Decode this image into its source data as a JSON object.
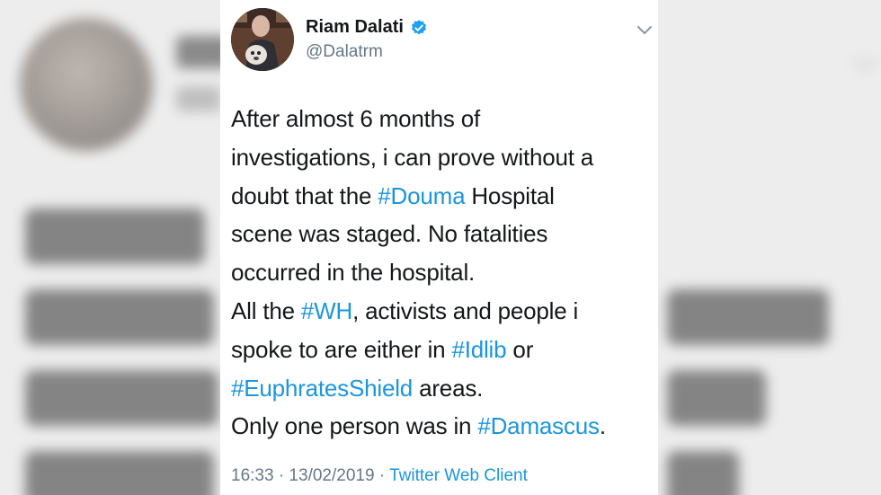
{
  "tweet": {
    "author_name": "Riam Dalati",
    "handle": "@Dalatrm",
    "lines": [
      [
        "After almost 6 months of"
      ],
      [
        "investigations, i can prove without a"
      ],
      [
        "doubt that the ",
        "#Douma",
        " Hospital"
      ],
      [
        "scene was staged. No fatalities"
      ],
      [
        "occurred in the hospital."
      ],
      [
        "All the ",
        "#WH",
        ", activists and people i"
      ],
      [
        "spoke to are either in ",
        "#Idlib",
        " or"
      ],
      [
        "#EuphratesShield",
        " areas."
      ],
      [
        "Only one person was in ",
        "#Damascus",
        "."
      ]
    ],
    "timestamp": "16:33 · 13/02/2019 · ",
    "client": "Twitter Web Client"
  },
  "icons": {
    "verified": "verified-badge-icon",
    "menu": "chevron-down-icon"
  },
  "colors": {
    "link": "#1b95e0",
    "text": "#14171a",
    "secondary": "#657786",
    "verified": "#1da1f2"
  },
  "background": {
    "blurred_text": [
      "After almost 6",
      "investigations, i can prove without a",
      "doubt that the #Douma Hospital",
      "scene was staged."
    ]
  }
}
